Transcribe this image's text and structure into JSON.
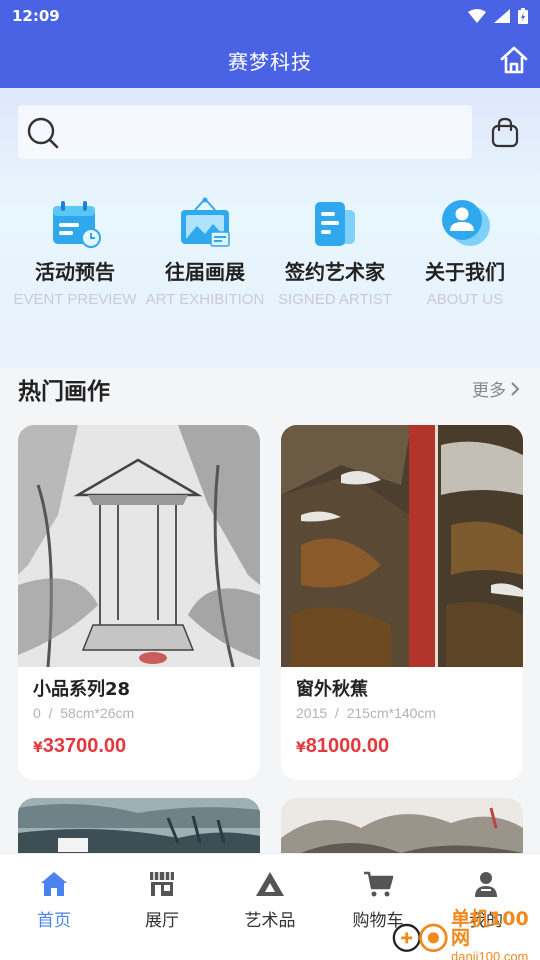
{
  "status_bar": {
    "time": "12:09"
  },
  "app_bar": {
    "title": "赛梦科技"
  },
  "menu": [
    {
      "label": "活动预告",
      "sub": "EVENT PREVIEW",
      "icon": "calendar-icon"
    },
    {
      "label": "往届画展",
      "sub": "ART EXHIBITION",
      "icon": "exhibition-icon"
    },
    {
      "label": "签约艺术家",
      "sub": "SIGNED ARTIST",
      "icon": "document-icon"
    },
    {
      "label": "关于我们",
      "sub": "ABOUT US",
      "icon": "user-circle-icon"
    }
  ],
  "section": {
    "title": "热门画作",
    "more": "更多"
  },
  "artworks": [
    {
      "name": "小品系列28",
      "year": "0",
      "size": "58cm*26cm",
      "currency": "¥",
      "price": "33700.00"
    },
    {
      "name": "窗外秋蕉",
      "year": "2015",
      "size": "215cm*140cm",
      "currency": "¥",
      "price": "81000.00"
    }
  ],
  "tabs": [
    {
      "label": "首页",
      "icon": "home-icon",
      "active": true
    },
    {
      "label": "展厅",
      "icon": "store-icon",
      "active": false
    },
    {
      "label": "艺术品",
      "icon": "triangle-icon",
      "active": false
    },
    {
      "label": "购物车",
      "icon": "cart-icon",
      "active": false
    },
    {
      "label": "我的",
      "icon": "person-icon",
      "active": false
    }
  ],
  "watermark": {
    "name": "单机100网",
    "url": "danji100.com"
  },
  "colors": {
    "primary": "#4a63e4",
    "price": "#e4393c",
    "tab_active": "#4a82f0"
  }
}
